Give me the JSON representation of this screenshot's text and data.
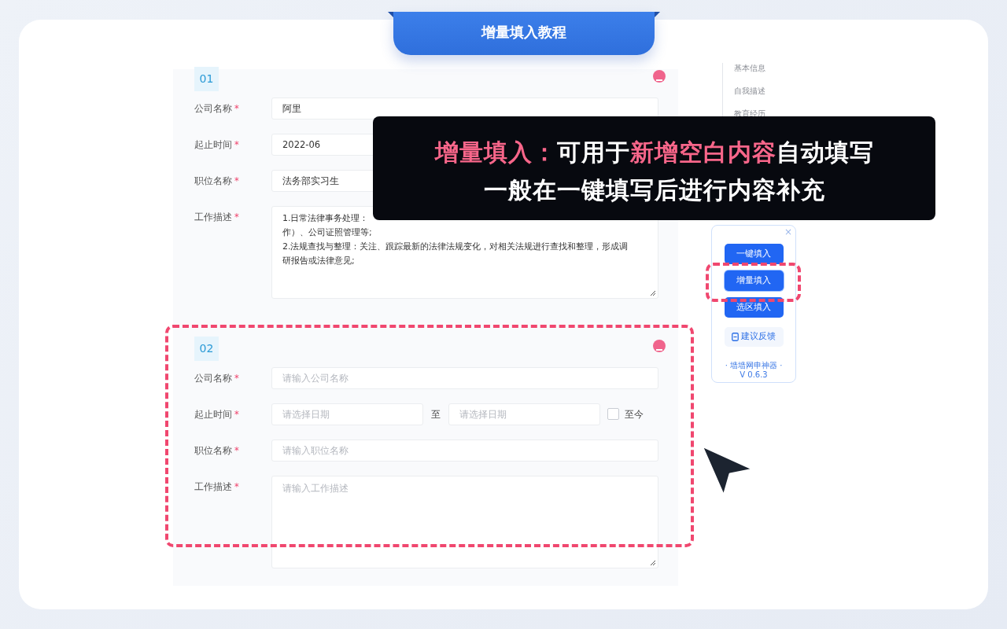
{
  "title_tab": {
    "label": "增量填入教程"
  },
  "entries": [
    {
      "number": "01",
      "highlighted": false,
      "fields": [
        {
          "kind": "text",
          "label": "公司名称",
          "mark": "*",
          "value": "阿里"
        },
        {
          "kind": "daterange",
          "label": "起止时间",
          "mark": "*",
          "start": {
            "value": "2022-06"
          }
        },
        {
          "kind": "text",
          "label": "职位名称",
          "mark": "*",
          "value": "法务部实习生"
        },
        {
          "kind": "textarea",
          "label": "工作描述",
          "mark": "*",
          "lines": [
            "1.日常法律事务处理：",
            "作）、公司证照管理等;",
            "2.法规查找与整理：关注、跟踪最新的法律法规变化，对相关法规进行查找和整理，形成调",
            "研报告或法律意见;"
          ]
        }
      ]
    },
    {
      "number": "02",
      "highlighted": true,
      "fields": [
        {
          "kind": "text",
          "label": "公司名称",
          "mark": "*",
          "placeholder": "请输入公司名称"
        },
        {
          "kind": "daterange",
          "label": "起止时间",
          "mark": "*",
          "start": {
            "placeholder": "请选择日期"
          },
          "separator": "至",
          "end": {
            "placeholder": "请选择日期"
          },
          "until_now": {
            "label": "至今",
            "checked": false
          }
        },
        {
          "kind": "text",
          "label": "职位名称",
          "mark": "*",
          "placeholder": "请输入职位名称"
        },
        {
          "kind": "textarea",
          "label": "工作描述",
          "mark": "*",
          "placeholder": "请输入工作描述"
        }
      ]
    }
  ],
  "side_nav": {
    "items": [
      "基本信息",
      "自我描述",
      "教育经历"
    ]
  },
  "widget": {
    "close": "×",
    "buttons": [
      {
        "label": "一键填入",
        "highlighted": false
      },
      {
        "label": "增量填入",
        "highlighted": true
      },
      {
        "label": "选区填入",
        "highlighted": false
      }
    ],
    "feedback": "建议反馈",
    "footer": [
      "· 墙墙网申神器 ·",
      "V 0.6.3"
    ]
  },
  "caption": {
    "lines": [
      [
        {
          "text": "增量填入：",
          "highlight": true
        },
        {
          "text": "可用于",
          "highlight": false
        },
        {
          "text": "新增空白内容",
          "highlight": true
        },
        {
          "text": "自动填写",
          "highlight": false
        }
      ],
      [
        {
          "text": "一般在一键填写后进行内容补充",
          "highlight": false
        }
      ]
    ]
  }
}
